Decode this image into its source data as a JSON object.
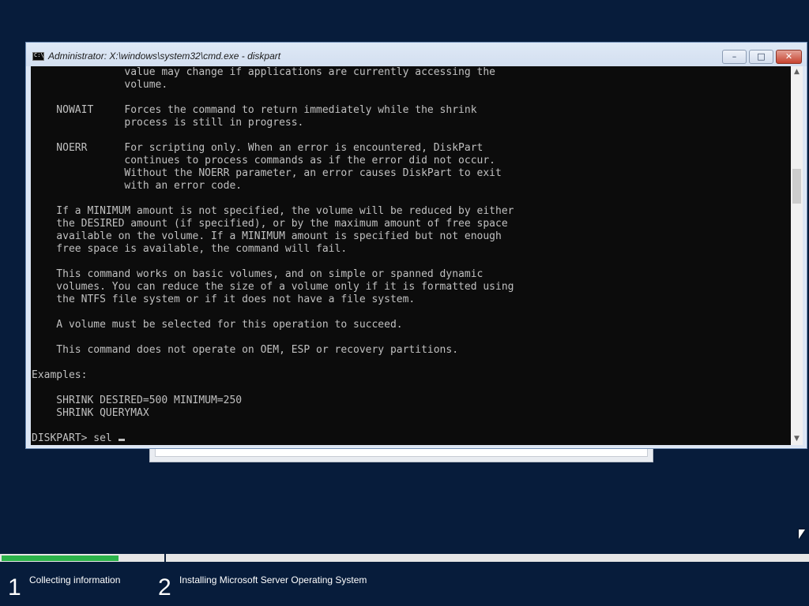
{
  "window": {
    "title": "Administrator: X:\\windows\\system32\\cmd.exe - diskpart",
    "icon_label": "C:\\",
    "minimize_glyph": "–",
    "maximize_glyph": "□",
    "close_glyph": "✕"
  },
  "console": {
    "lines": [
      "               value may change if applications are currently accessing the",
      "               volume.",
      "",
      "    NOWAIT     Forces the command to return immediately while the shrink",
      "               process is still in progress.",
      "",
      "    NOERR      For scripting only. When an error is encountered, DiskPart",
      "               continues to process commands as if the error did not occur.",
      "               Without the NOERR parameter, an error causes DiskPart to exit",
      "               with an error code.",
      "",
      "    If a MINIMUM amount is not specified, the volume will be reduced by either",
      "    the DESIRED amount (if specified), or by the maximum amount of free space",
      "    available on the volume. If a MINIMUM amount is specified but not enough",
      "    free space is available, the command will fail.",
      "",
      "    This command works on basic volumes, and on simple or spanned dynamic",
      "    volumes. You can reduce the size of a volume only if it is formatted using",
      "    the NTFS file system or if it does not have a file system.",
      "",
      "    A volume must be selected for this operation to succeed.",
      "",
      "    This command does not operate on OEM, ESP or recovery partitions.",
      "",
      "Examples:",
      "",
      "    SHRINK DESIRED=500 MINIMUM=250",
      "    SHRINK QUERYMAX",
      ""
    ],
    "prompt": "DISKPART> ",
    "input": "sel "
  },
  "scrollbar": {
    "up_glyph": "▲",
    "down_glyph": "▼"
  },
  "setup": {
    "progress_fraction": 0.72,
    "steps": [
      {
        "number": "1",
        "label": "Collecting information"
      },
      {
        "number": "2",
        "label": "Installing Microsoft Server Operating System"
      }
    ]
  },
  "colors": {
    "desktop_bg": "#071c3b",
    "console_bg": "#0c0c0c",
    "console_text": "#c0c0c0",
    "progress_fill": "#2cb34a"
  }
}
